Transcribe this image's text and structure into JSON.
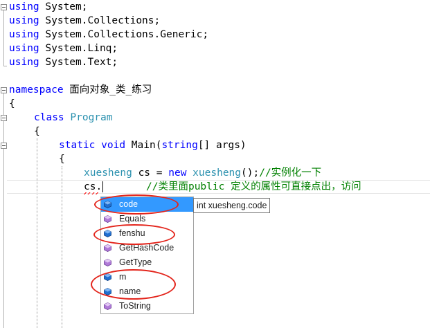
{
  "code": {
    "using1": {
      "kw": "using",
      "rest": " System;"
    },
    "using2": {
      "kw": "using",
      "rest": " System.Collections;"
    },
    "using3": {
      "kw": "using",
      "rest": " System.Collections.Generic;"
    },
    "using4": {
      "kw": "using",
      "rest": " System.Linq;"
    },
    "using5": {
      "kw": "using",
      "rest": " System.Text;"
    },
    "ns": {
      "kw": "namespace",
      "name": " 面向对象_类_练习"
    },
    "brace_open": "{",
    "class_line": {
      "kw": "class",
      "name": "Program"
    },
    "brace_open2": "{",
    "main_line": {
      "kw1": "static",
      "kw2": "void",
      "rest1": " Main(",
      "kw3": "string",
      "rest2": "[] args)"
    },
    "brace_open3": "{",
    "decl_line": {
      "type1": "xuesheng",
      "rest1": " cs = ",
      "kw": "new",
      "type2": "xuesheng",
      "rest2": "();",
      "comment": "//实例化一下"
    },
    "access_line": {
      "text": "cs.",
      "comment": "//类里面public 定义的属性可直接点出，访问"
    }
  },
  "completion": {
    "items": [
      {
        "label": "code",
        "icon": "field-icon",
        "selected": true
      },
      {
        "label": "Equals",
        "icon": "method-icon",
        "selected": false
      },
      {
        "label": "fenshu",
        "icon": "field-icon",
        "selected": false
      },
      {
        "label": "GetHashCode",
        "icon": "method-icon",
        "selected": false
      },
      {
        "label": "GetType",
        "icon": "method-icon",
        "selected": false
      },
      {
        "label": "m",
        "icon": "field-icon",
        "selected": false
      },
      {
        "label": "name",
        "icon": "field-icon",
        "selected": false
      },
      {
        "label": "ToString",
        "icon": "method-icon",
        "selected": false
      }
    ],
    "tooltip": "int xuesheng.code"
  },
  "colors": {
    "keyword": "#0000ff",
    "type": "#2b91af",
    "comment": "#008000",
    "selection": "#3399ff",
    "annotation": "#e3241b"
  }
}
